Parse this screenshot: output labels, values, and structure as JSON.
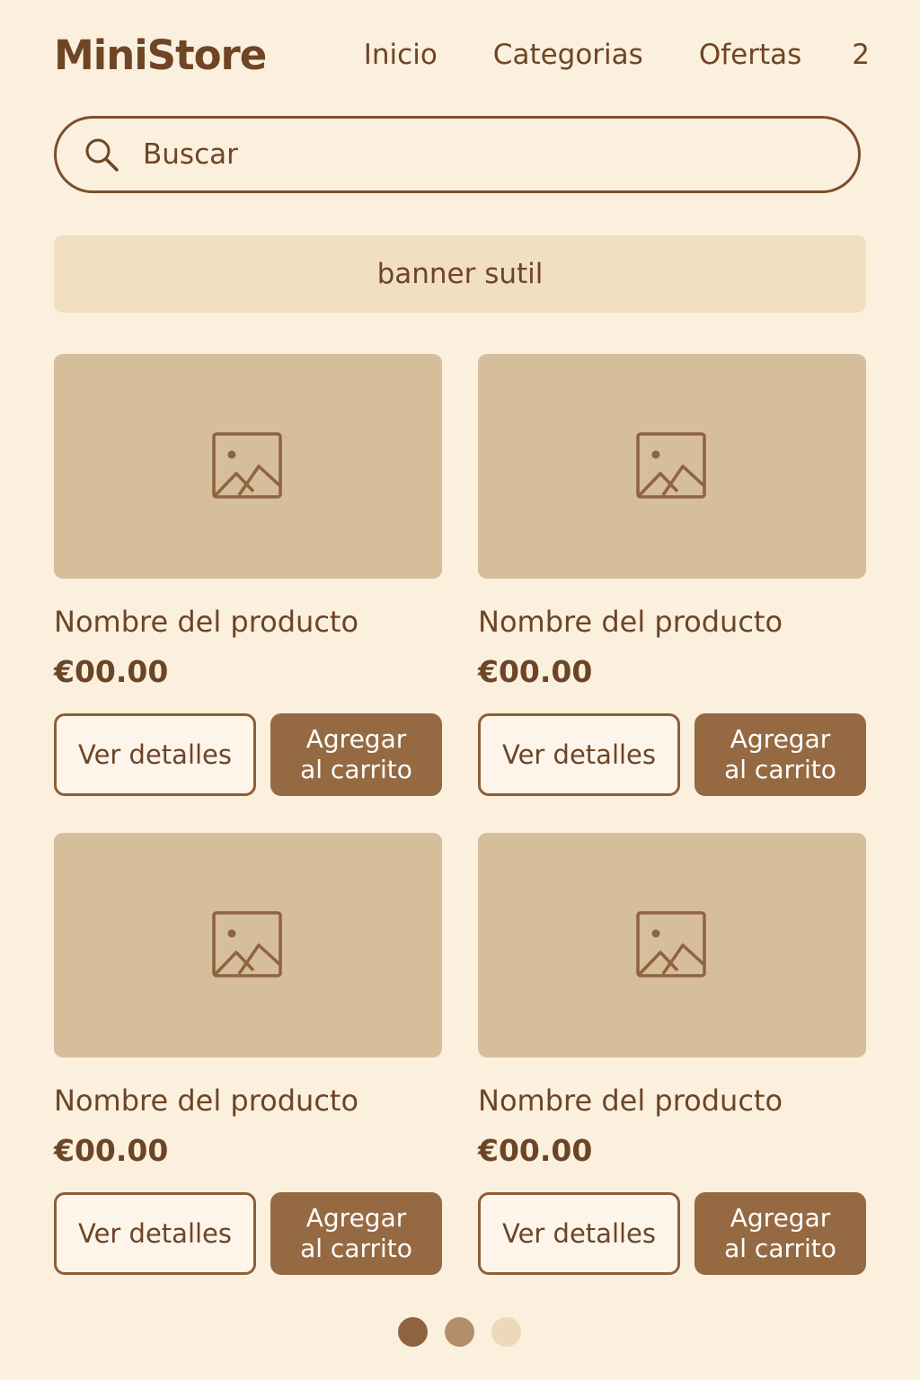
{
  "header": {
    "logo": "MiniStore",
    "nav": [
      "Inicio",
      "Categorias",
      "Ofertas"
    ],
    "cart_count": "2"
  },
  "search": {
    "placeholder": "Buscar",
    "icon": "search-icon"
  },
  "banner": {
    "text": "banner sutil"
  },
  "products": [
    {
      "name": "Nombre del producto",
      "price": "€00.00",
      "details_label": "Ver detalles",
      "cart_label": "Agregar\nal carrito",
      "image_icon": "image-placeholder-icon"
    },
    {
      "name": "Nombre del producto",
      "price": "€00.00",
      "details_label": "Ver detalles",
      "cart_label": "Agregar\nal carrito",
      "image_icon": "image-placeholder-icon"
    },
    {
      "name": "Nombre del producto",
      "price": "€00.00",
      "details_label": "Ver detalles",
      "cart_label": "Agregar\nal carrito",
      "image_icon": "image-placeholder-icon"
    },
    {
      "name": "Nombre del producto",
      "price": "€00.00",
      "details_label": "Ver detalles",
      "cart_label": "Agregar\nal carrito",
      "image_icon": "image-placeholder-icon"
    }
  ],
  "pagination": {
    "active_page": 1,
    "page_count": 3
  },
  "colors": {
    "background": "#fbefdd",
    "text": "#6b4526",
    "accent": "#956a42",
    "image_bg": "#d6bd9b",
    "banner_bg": "#f1dfc2",
    "dot_active": "#8e6340",
    "dot_mid": "#b48e69",
    "dot_inactive": "#ecd9bb"
  }
}
